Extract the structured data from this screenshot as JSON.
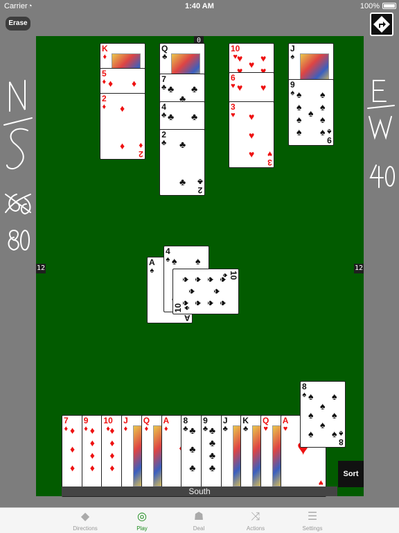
{
  "status_bar": {
    "carrier": "Carrier",
    "time": "1:40 AM",
    "battery": "100%"
  },
  "erase_label": "Erase",
  "scores": {
    "top": "0",
    "left": "12",
    "right": "12"
  },
  "handwriting": {
    "left_team": "N/S",
    "left_scores": [
      "60",
      "80"
    ],
    "right_team": "E/W",
    "right_score": "40"
  },
  "north_columns": [
    {
      "suit": "♦",
      "color": "red",
      "cards": [
        "K",
        "5",
        "2"
      ]
    },
    {
      "suit": "♣",
      "color": "black",
      "cards": [
        "Q",
        "7",
        "4",
        "2"
      ]
    },
    {
      "suit": "♥",
      "color": "red",
      "cards": [
        "10",
        "6",
        "3"
      ]
    },
    {
      "suit": "♠",
      "color": "black",
      "cards": [
        "J",
        "9"
      ]
    }
  ],
  "trick": [
    {
      "rank": "A",
      "suit": "♠",
      "color": "black"
    },
    {
      "rank": "4",
      "suit": "♠",
      "color": "black"
    },
    {
      "rank": "10",
      "suit": "♠",
      "color": "black"
    }
  ],
  "south_hand": [
    {
      "rank": "7",
      "suit": "♦",
      "color": "red"
    },
    {
      "rank": "9",
      "suit": "♦",
      "color": "red"
    },
    {
      "rank": "10",
      "suit": "♦",
      "color": "red"
    },
    {
      "rank": "J",
      "suit": "♦",
      "color": "red"
    },
    {
      "rank": "Q",
      "suit": "♦",
      "color": "red"
    },
    {
      "rank": "A",
      "suit": "♦",
      "color": "red"
    },
    {
      "rank": "8",
      "suit": "♣",
      "color": "black"
    },
    {
      "rank": "9",
      "suit": "♣",
      "color": "black"
    },
    {
      "rank": "J",
      "suit": "♣",
      "color": "black"
    },
    {
      "rank": "K",
      "suit": "♣",
      "color": "black"
    },
    {
      "rank": "Q",
      "suit": "♥",
      "color": "red"
    },
    {
      "rank": "A",
      "suit": "♥",
      "color": "red"
    }
  ],
  "selected_card": {
    "rank": "8",
    "suit": "♠",
    "color": "black"
  },
  "sort_label": "Sort",
  "south_label": "South",
  "tabs": [
    {
      "label": "Directions",
      "icon": "directions-icon"
    },
    {
      "label": "Play",
      "icon": "play-icon",
      "active": true
    },
    {
      "label": "Deal",
      "icon": "deal-icon"
    },
    {
      "label": "Actions",
      "icon": "shuffle-icon"
    },
    {
      "label": "Settings",
      "icon": "settings-icon"
    }
  ]
}
